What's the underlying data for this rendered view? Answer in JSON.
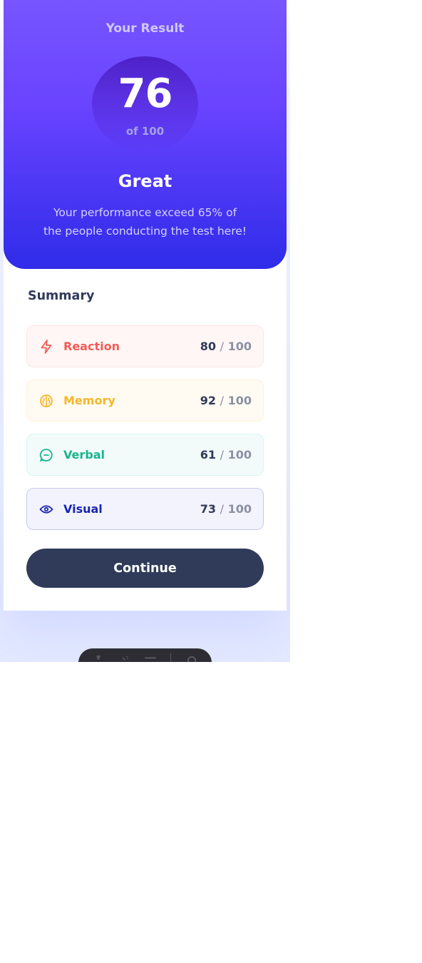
{
  "result": {
    "title": "Your Result",
    "score": "76",
    "score_of": "of 100",
    "grade": "Great",
    "description": "Your performance exceed 65% of the people conducting the test here!"
  },
  "summary": {
    "title": "Summary",
    "items": [
      {
        "label": "Reaction",
        "score": "80",
        "max": "100",
        "icon": "lightning-icon",
        "color": "#f55c57"
      },
      {
        "label": "Memory",
        "score": "92",
        "max": "100",
        "icon": "brain-icon",
        "color": "#f5b72a"
      },
      {
        "label": "Verbal",
        "score": "61",
        "max": "100",
        "icon": "chat-bubble-icon",
        "color": "#19b48d"
      },
      {
        "label": "Visual",
        "score": "73",
        "max": "100",
        "icon": "eye-icon",
        "color": "#1a25b5"
      }
    ],
    "separator": "/"
  },
  "actions": {
    "continue_label": "Continue"
  },
  "colors": {
    "gradient_top": "#7755ff",
    "gradient_bottom": "#2f2ce9",
    "button": "#303b5a"
  },
  "toolbar": {
    "icons": [
      "cursor-icon",
      "inspect-icon",
      "menu-icon",
      "gear-icon"
    ]
  }
}
